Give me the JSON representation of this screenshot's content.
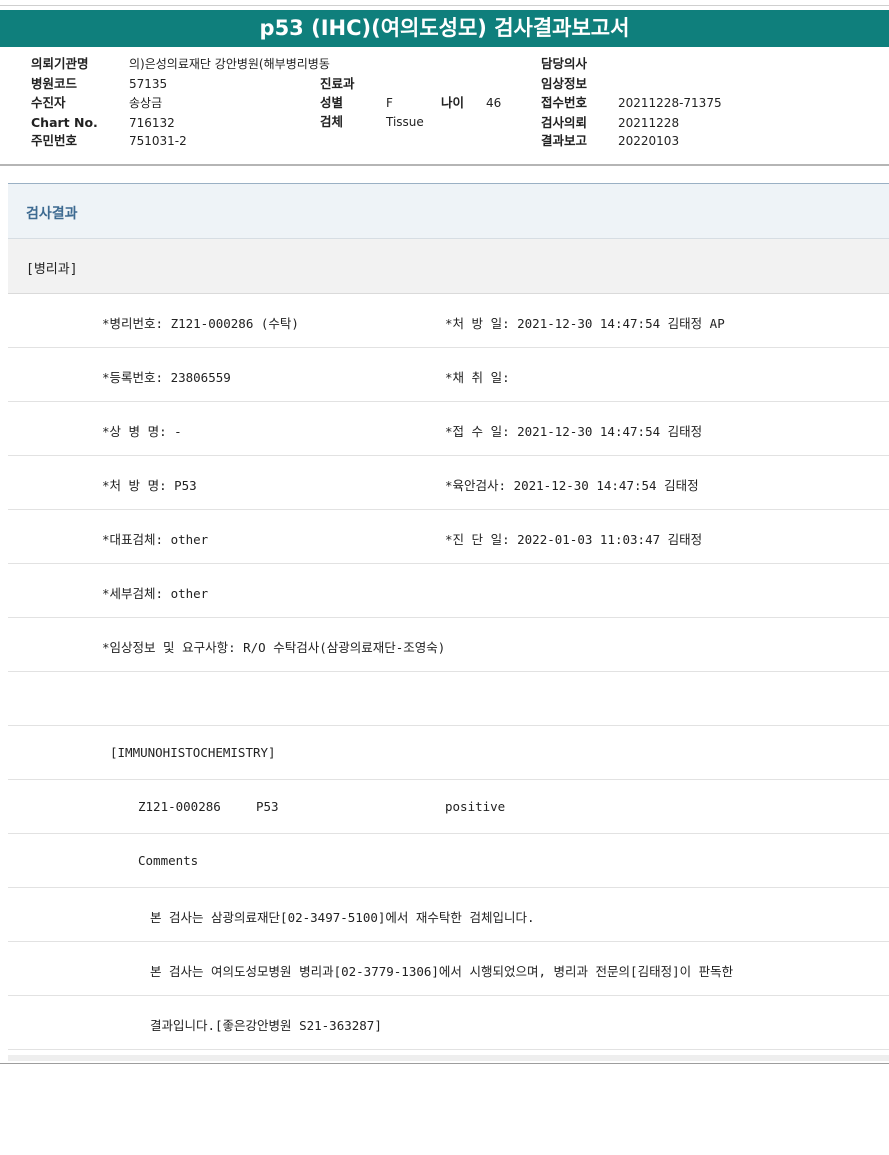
{
  "report": {
    "title": "p53 (IHC)(여의도성모) 검사결과보고서"
  },
  "header": {
    "institution_label": "의뢰기관명",
    "institution_value": "의)은성의료재단 강안병원(해부병리병동",
    "doctor_label": "담당의사",
    "doctor_value": "",
    "hospital_code_label": "병원코드",
    "hospital_code_value": "57135",
    "department_label": "진료과",
    "department_value": "",
    "clinical_info_label": "임상정보",
    "clinical_info_value": "",
    "patient_label": "수진자",
    "patient_value": "송상금",
    "sex_label": "성별",
    "sex_value": "F",
    "age_label": "나이",
    "age_value": "46",
    "receipt_no_label": "접수번호",
    "receipt_no_value": "20211228-71375",
    "chart_no_label": "Chart No.",
    "chart_no_value": "716132",
    "specimen_label": "검체",
    "specimen_value": "Tissue",
    "request_label": "검사의뢰",
    "request_value": "20211228",
    "resident_no_label": "주민번호",
    "resident_no_value": "751031-2",
    "report_label": "결과보고",
    "report_value": "20220103"
  },
  "result": {
    "section_title": "검사결과",
    "department": "[병리과]",
    "left_fields": [
      "*병리번호: Z121-000286 (수탁)",
      "*등록번호: 23806559",
      "*상 병 명: -",
      "*처 방 명: P53",
      "*대표검체: other",
      "*세부검체: other",
      "*임상정보 및 요구사항: R/O 수탁검사(삼광의료재단-조영숙)"
    ],
    "right_fields": [
      "*처 방 일: 2021-12-30 14:47:54  김태정 AP",
      "*채 취 일:",
      "*접 수 일: 2021-12-30 14:47:54  김태정",
      "*육안검사: 2021-12-30 14:47:54  김태정",
      "*진 단 일: 2022-01-03 11:03:47  김태정"
    ],
    "ihc_heading": "[IMMUNOHISTOCHEMISTRY]",
    "ihc_case": "Z121-000286",
    "ihc_marker": "P53",
    "ihc_result": "positive",
    "comments_label": "Comments",
    "comment_1": "본 검사는 삼광의료재단[02-3497-5100]에서 재수탁한 검체입니다.",
    "comment_2": "본 검사는 여의도성모병원 병리과[02-3779-1306]에서 시행되었으며, 병리과 전문의[김태정]이 판독한",
    "comment_3": "결과입니다.[좋은강안병원 S21-363287]"
  }
}
